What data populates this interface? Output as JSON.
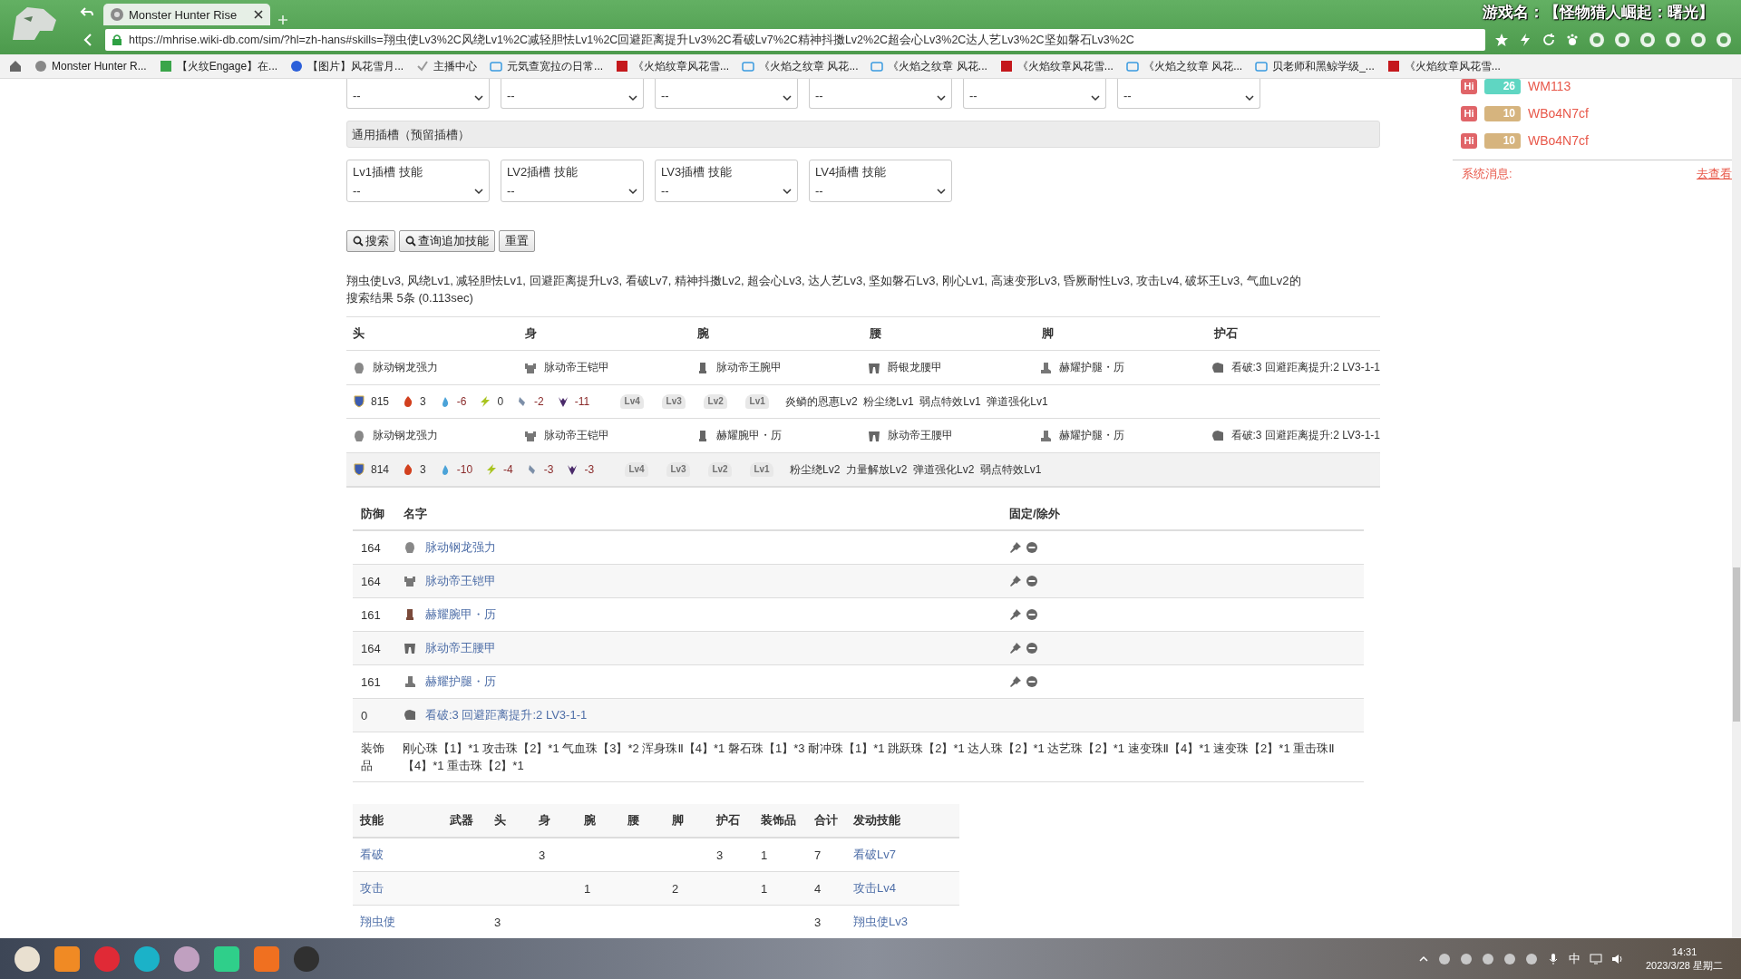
{
  "browser": {
    "tab_title": "Monster Hunter Rise",
    "url": "https://mhrise.wiki-db.com/sim/?hl=zh-hans#skills=翔虫使Lv3%2C风绕Lv1%2C减轻胆怯Lv1%2C回避距离提升Lv3%2C看破Lv7%2C精神抖擞Lv2%2C超会心Lv3%2C达人艺Lv3%2C坚如磐石Lv3%2C",
    "overlay_text": "游戏名：【怪物猎人崛起：曙光】",
    "bookmarks": [
      "Monster Hunter R...",
      "【火纹Engage】在...",
      "【图片】风花雪月...",
      "主播中心",
      "元気查宽拉の日常...",
      "《火焰纹章风花雪...",
      "《火焰之纹章 风花...",
      "《火焰之纹章 风花...",
      "《火焰纹章风花雪...",
      "《火焰之纹章 风花...",
      "贝老师和黑鲸学级_...",
      "《火焰纹章风花雪..."
    ]
  },
  "top_selects": [
    "--",
    "--",
    "--",
    "--",
    "--",
    "--"
  ],
  "slot_section": {
    "title": "通用插槽（预留插槽）",
    "selects": [
      {
        "label": "Lv1插槽 技能",
        "value": "--"
      },
      {
        "label": "LV2插槽 技能",
        "value": "--"
      },
      {
        "label": "LV3插槽 技能",
        "value": "--"
      },
      {
        "label": "LV4插槽 技能",
        "value": "--"
      }
    ]
  },
  "buttons": [
    "搜索",
    "查询追加技能",
    "重置"
  ],
  "query_text": "翔虫使Lv3, 风绕Lv1, 减轻胆怯Lv1, 回避距离提升Lv3, 看破Lv7, 精神抖擞Lv2, 超会心Lv3, 达人艺Lv3, 坚如磐石Lv3, 刚心Lv1, 高速变形Lv3, 昏厥耐性Lv3, 攻击Lv4, 破坏王Lv3, 气血Lv2的",
  "result_summary": "搜索结果 5条 (0.113sec)",
  "results": {
    "columns": [
      "头",
      "身",
      "腕",
      "腰",
      "脚",
      "护石"
    ],
    "sets": [
      {
        "selected": false,
        "pieces": [
          {
            "kind": "head",
            "name": "脉动钢龙强力"
          },
          {
            "kind": "body",
            "name": "脉动帝王铠甲"
          },
          {
            "kind": "arm",
            "name": "脉动帝王腕甲"
          },
          {
            "kind": "waist",
            "name": "爵银龙腰甲"
          },
          {
            "kind": "leg",
            "name": "赫耀护腿・历"
          },
          {
            "kind": "charm",
            "name": "看破:3 回避距离提升:2 LV3-1-1"
          }
        ],
        "stats": [
          {
            "kind": "defense",
            "value": "815",
            "negative": false
          },
          {
            "kind": "fire",
            "value": "3",
            "negative": false
          },
          {
            "kind": "water",
            "value": "-6",
            "negative": true
          },
          {
            "kind": "thunder",
            "value": "0",
            "negative": false
          },
          {
            "kind": "ice",
            "value": "-2",
            "negative": true
          },
          {
            "kind": "dragon",
            "value": "-11",
            "negative": true
          }
        ],
        "slots": [
          "Lv4",
          "Lv3",
          "Lv2",
          "Lv1"
        ],
        "extra_skills": [
          "炎鳞的恩惠Lv2",
          "粉尘绕Lv1",
          "弱点特效Lv1",
          "弹道强化Lv1"
        ]
      },
      {
        "selected": true,
        "pieces": [
          {
            "kind": "head",
            "name": "脉动钢龙强力"
          },
          {
            "kind": "body",
            "name": "脉动帝王铠甲"
          },
          {
            "kind": "arm",
            "name": "赫耀腕甲・历"
          },
          {
            "kind": "waist",
            "name": "脉动帝王腰甲"
          },
          {
            "kind": "leg",
            "name": "赫耀护腿・历"
          },
          {
            "kind": "charm",
            "name": "看破:3 回避距离提升:2 LV3-1-1"
          }
        ],
        "stats": [
          {
            "kind": "defense",
            "value": "814",
            "negative": false
          },
          {
            "kind": "fire",
            "value": "3",
            "negative": false
          },
          {
            "kind": "water",
            "value": "-10",
            "negative": true
          },
          {
            "kind": "thunder",
            "value": "-4",
            "negative": true
          },
          {
            "kind": "ice",
            "value": "-3",
            "negative": true
          },
          {
            "kind": "dragon",
            "value": "-3",
            "negative": true
          }
        ],
        "slots": [
          "Lv4",
          "Lv3",
          "Lv2",
          "Lv1"
        ],
        "extra_skills": [
          "粉尘绕Lv2",
          "力量解放Lv2",
          "弹道强化Lv2",
          "弱点特效Lv1"
        ]
      }
    ]
  },
  "detail": {
    "columns": [
      "防御",
      "名字",
      "固定/除外"
    ],
    "rows": [
      {
        "defense": "164",
        "kind": "head",
        "name": "脉动钢龙强力",
        "pinnable": true
      },
      {
        "defense": "164",
        "kind": "body",
        "name": "脉动帝王铠甲",
        "pinnable": true
      },
      {
        "defense": "161",
        "kind": "arm",
        "name": "赫耀腕甲・历",
        "pinnable": true
      },
      {
        "defense": "164",
        "kind": "waist",
        "name": "脉动帝王腰甲",
        "pinnable": true
      },
      {
        "defense": "161",
        "kind": "leg",
        "name": "赫耀护腿・历",
        "pinnable": true
      },
      {
        "defense": "0",
        "kind": "charm",
        "name": "看破:3 回避距离提升:2 LV3-1-1",
        "pinnable": false
      }
    ],
    "decorations_label": "装饰品",
    "decorations": "刚心珠【1】*1 攻击珠【2】*1 气血珠【3】*2 浑身珠Ⅱ【4】*1 磐石珠【1】*3 耐冲珠【1】*1 跳跃珠【2】*1 达人珠【2】*1 达艺珠【2】*1 速变珠Ⅱ【4】*1 速变珠【2】*1 重击珠Ⅱ【4】*1 重击珠【2】*1"
  },
  "skills_table": {
    "columns": [
      "技能",
      "武器",
      "头",
      "身",
      "腕",
      "腰",
      "脚",
      "护石",
      "装饰品",
      "合计",
      "发动技能"
    ],
    "rows": [
      [
        "看破",
        "",
        "",
        "3",
        "",
        "",
        "",
        "3",
        "1",
        "7",
        "看破Lv7"
      ],
      [
        "攻击",
        "",
        "",
        "",
        "1",
        "",
        "2",
        "",
        "1",
        "4",
        "攻击Lv4"
      ],
      [
        "翔虫使",
        "",
        "3",
        "",
        "",
        "",
        "",
        "",
        "",
        "3",
        "翔虫使Lv3"
      ]
    ]
  },
  "side_panel": {
    "users": [
      {
        "tag": "Hi",
        "level": "26",
        "color": "#5fd6c2",
        "name": "WM113"
      },
      {
        "tag": "Hi",
        "level": "10",
        "color": "#d6b47e",
        "name": "WBo4N7cf"
      },
      {
        "tag": "Hi",
        "level": "10",
        "color": "#d6b47e",
        "name": "WBo4N7cf"
      }
    ],
    "system_label": "系统消息:",
    "link": "去查看"
  },
  "taskbar": {
    "ime": "中",
    "time": "14:31",
    "date": "2023/3/28 星期二"
  }
}
